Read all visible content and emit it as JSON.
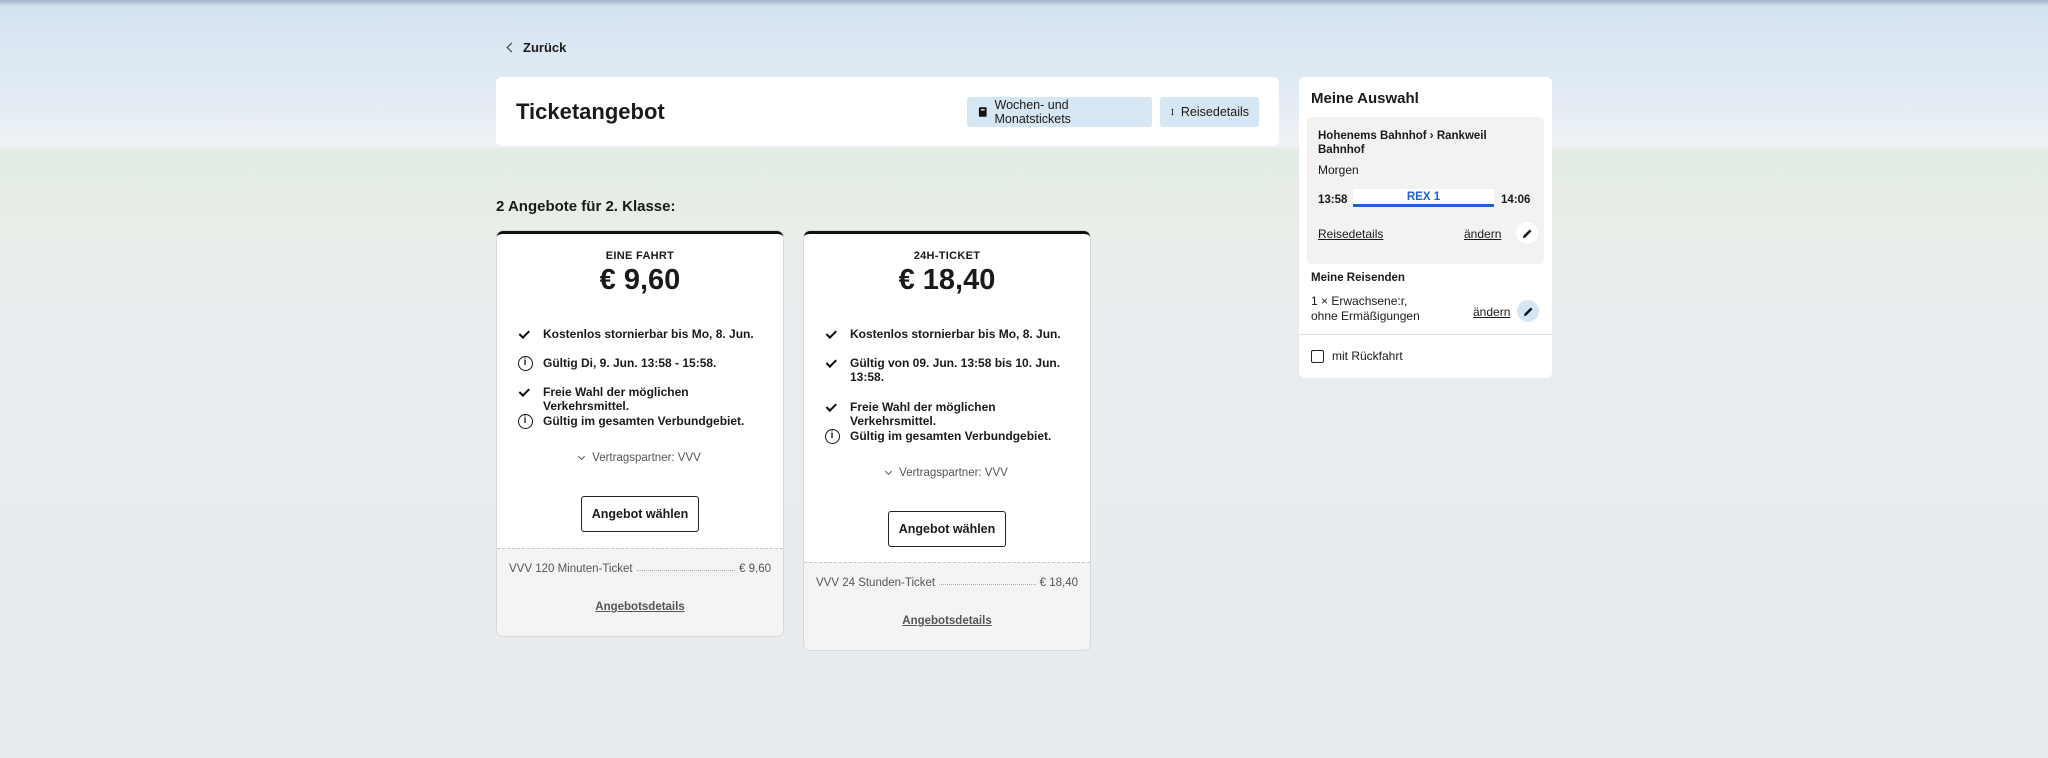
{
  "nav": {
    "back_label": "Zurück"
  },
  "header": {
    "title": "Ticketangebot",
    "weekly_button": "Wochen- und Monatstickets",
    "details_button": "Reisedetails"
  },
  "selection": {
    "title": "Meine Auswahl",
    "route": "Hohenems Bahnhof › Rankweil Bahnhof",
    "time_of_day": "Morgen",
    "departure": "13:58",
    "arrival": "14:06",
    "line": "REX 1",
    "details_link": "Reisedetails",
    "change_link": "ändern",
    "travellers_title": "Meine Reisenden",
    "travellers_line1": "1 × Erwachsene:r,",
    "travellers_line2": "ohne Ermäßigungen",
    "travellers_change": "ändern",
    "return_label": "mit Rückfahrt",
    "line_color": "#1f5fd6"
  },
  "offers_title": "2 Angebote für 2. Klasse:",
  "offers": [
    {
      "kind": "EINE FAHRT",
      "price": "€ 9,60",
      "features": [
        {
          "icon": "check-icon",
          "text": "Kostenlos stornierbar bis Mo, 8. Jun."
        },
        {
          "icon": "info-icon",
          "text": "Gültig Di, 9. Jun. 13:58 - 15:58."
        },
        {
          "icon": "check-icon",
          "text": "Freie Wahl der möglichen Verkehrsmittel."
        },
        {
          "icon": "info-icon",
          "text": "Gültig im gesamten Verbundgebiet."
        }
      ],
      "partner": "Vertragspartner:  VVV",
      "choose_label": "Angebot wählen",
      "product": "VVV 120 Minuten-Ticket",
      "product_price": "€ 9,60",
      "details_label": "Angebotsdetails"
    },
    {
      "kind": "24H-TICKET",
      "price": "€ 18,40",
      "features": [
        {
          "icon": "check-icon",
          "text": "Kostenlos stornierbar bis Mo, 8. Jun."
        },
        {
          "icon": "check-icon",
          "text": "Gültig von 09. Jun. 13:58 bis 10. Jun. 13:58."
        },
        {
          "icon": "check-icon",
          "text": "Freie Wahl der möglichen Verkehrsmittel."
        },
        {
          "icon": "info-icon",
          "text": "Gültig im gesamten Verbundgebiet."
        }
      ],
      "partner": "Vertragspartner:  VVV",
      "choose_label": "Angebot wählen",
      "product": "VVV 24 Stunden-Ticket",
      "product_price": "€ 18,40",
      "details_label": "Angebotsdetails"
    }
  ]
}
